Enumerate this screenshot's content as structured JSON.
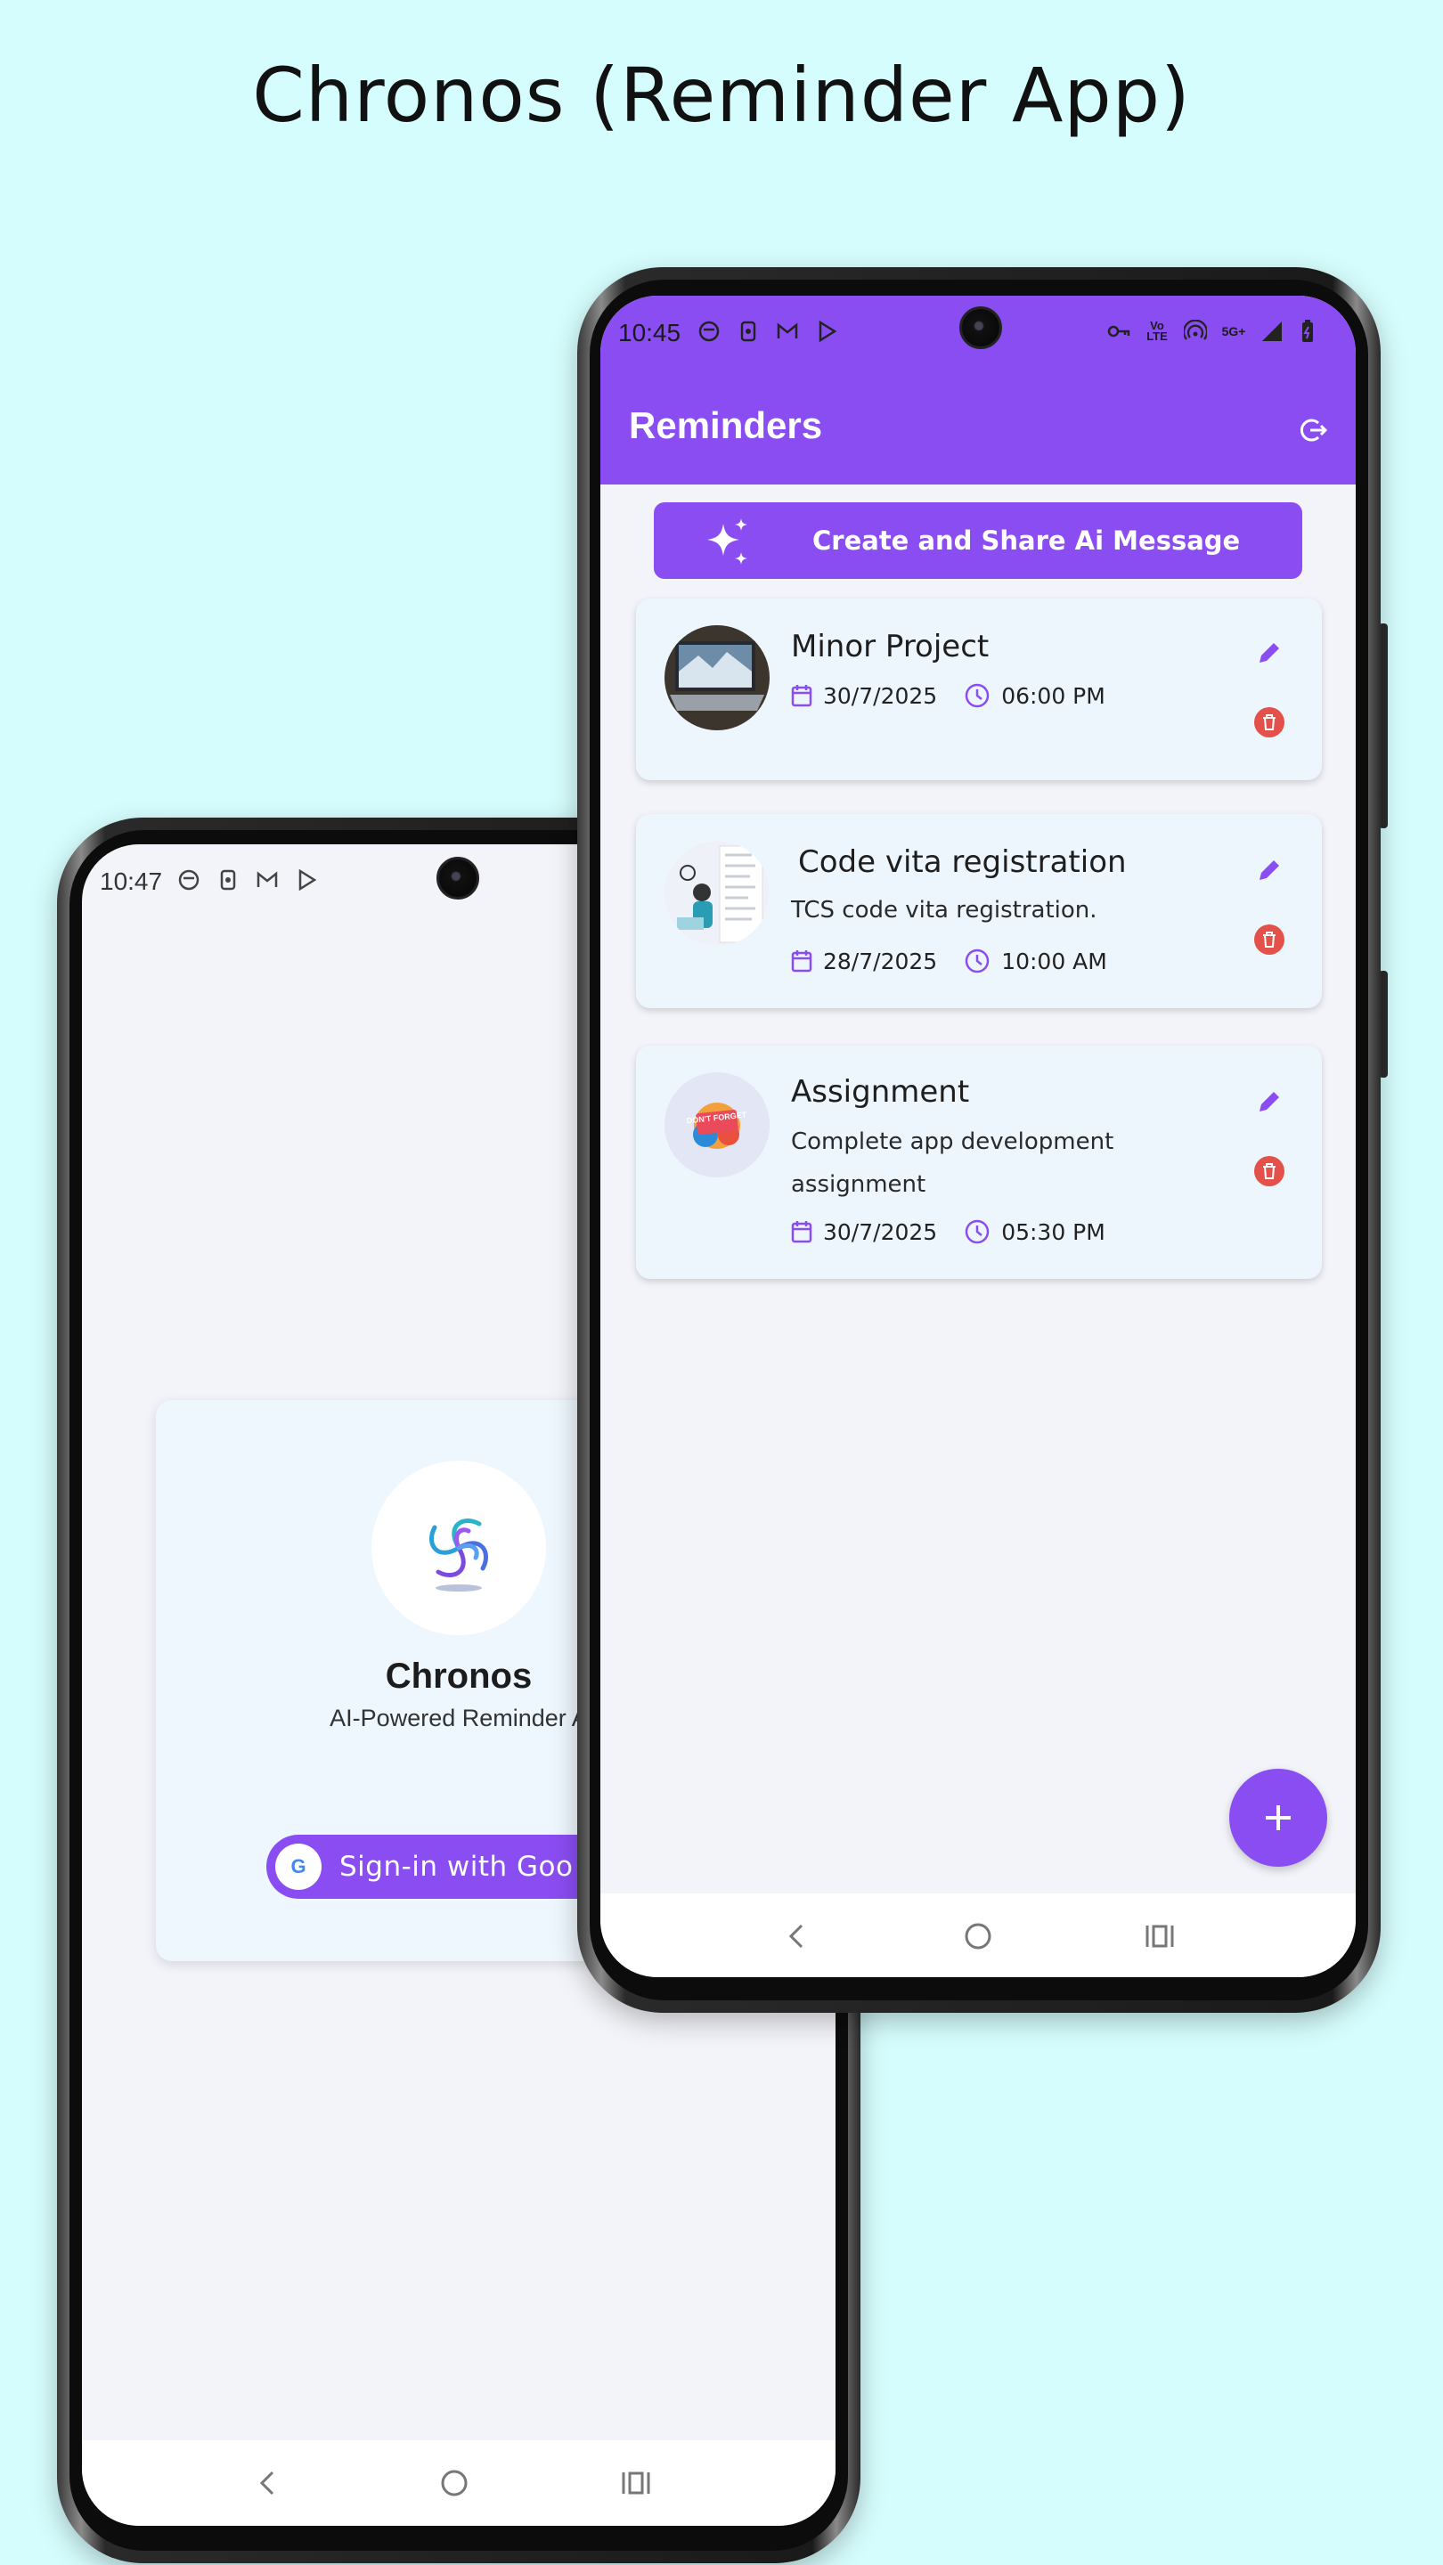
{
  "headline": "Chronos (Reminder App)",
  "login_screen": {
    "status_time": "10:47",
    "app_name": "Chronos",
    "tagline": "AI-Powered Reminder A",
    "google_button_label": "Sign-in with Goo",
    "google_icon_letter": "G"
  },
  "reminders_screen": {
    "status_time": "10:45",
    "status_icons": [
      "vpn-key-icon",
      "volte-icon",
      "hotspot-icon",
      "5g-icon",
      "signal-icon",
      "battery-icon"
    ],
    "network_label": "5G+",
    "volte_label": "Vo LTE",
    "title": "Reminders",
    "ai_button_label": "Create and Share Ai Message",
    "accent_color": "#8a4df2",
    "delete_color": "#e4504a",
    "reminders": [
      {
        "title": "Minor Project",
        "description": "",
        "date": "30/7/2025",
        "time": "06:00 PM",
        "thumbnail": "laptop-photo"
      },
      {
        "title": "Code vita registration",
        "description": "TCS code vita registration.",
        "date": "28/7/2025",
        "time": "10:00 AM",
        "thumbnail": "registration-illustration"
      },
      {
        "title": "Assignment",
        "description": "Complete app development assignment",
        "date": "30/7/2025",
        "time": "05:30 PM",
        "thumbnail": "dont-forget-sticker"
      }
    ],
    "thumbnail_text": "DON'T FORGET"
  }
}
